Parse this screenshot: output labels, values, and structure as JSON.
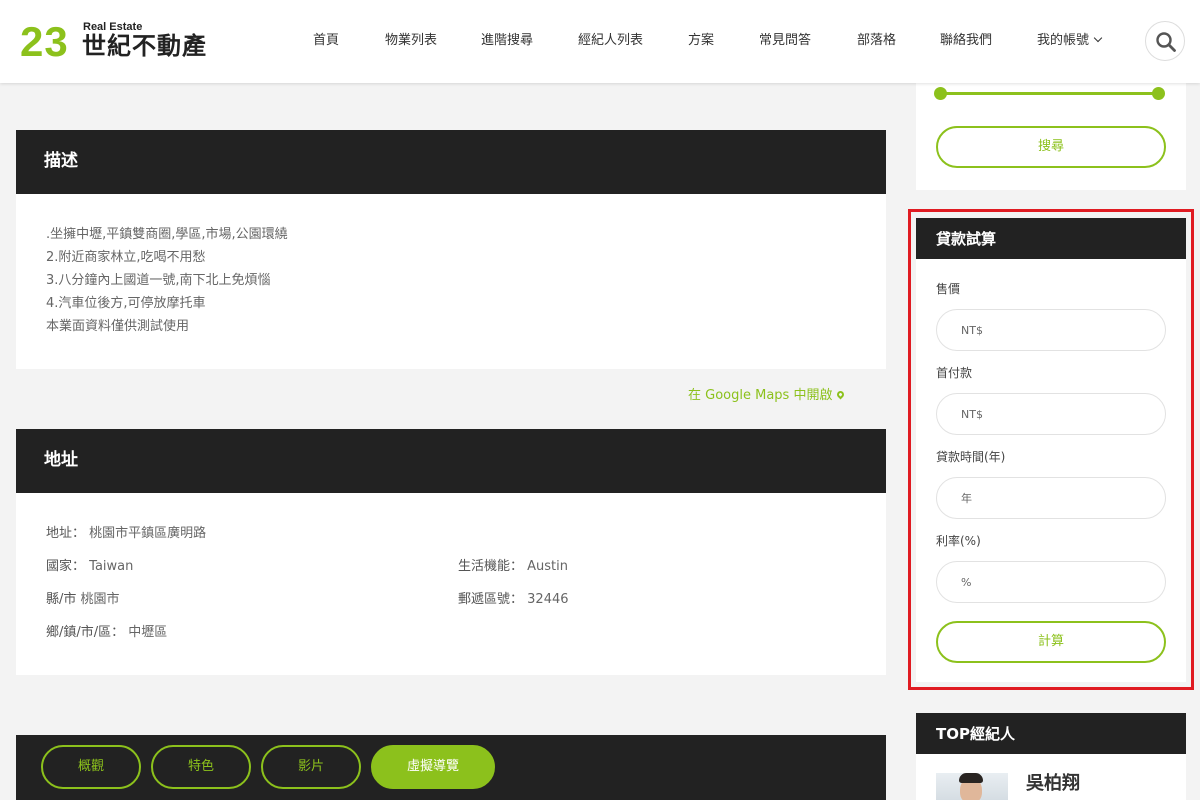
{
  "header": {
    "logo_number": "23",
    "logo_en": "Real Estate",
    "logo_cn": "世紀不動產",
    "nav": [
      {
        "label": "首頁"
      },
      {
        "label": "物業列表"
      },
      {
        "label": "進階搜尋"
      },
      {
        "label": "經紀人列表"
      },
      {
        "label": "方案"
      },
      {
        "label": "常見問答"
      },
      {
        "label": "部落格"
      },
      {
        "label": "聯絡我們"
      },
      {
        "label": "我的帳號"
      }
    ]
  },
  "description": {
    "title": "描述",
    "lines": [
      ".坐擁中壢,平鎮雙商圈,學區,市場,公園環繞",
      "2.附近商家林立,吃喝不用愁",
      "3.八分鐘內上國道一號,南下北上免煩惱",
      "4.汽車位後方,可停放摩托車",
      "本業面資料僅供測試使用"
    ]
  },
  "google_maps_link": "在 Google Maps 中開啟",
  "address": {
    "title": "地址",
    "street_label": "地址：",
    "street_value": "桃園市平鎮區廣明路",
    "country_label": "國家：",
    "country_value": "Taiwan",
    "county_label": "縣/市",
    "county_value": "桃園市",
    "township_label": "鄉/鎮/市/區：",
    "township_value": "中壢區",
    "amenity_label": "生活機能：",
    "amenity_value": "Austin",
    "zip_label": "郵遞區號：",
    "zip_value": "32446"
  },
  "tabs": [
    {
      "label": "概觀"
    },
    {
      "label": "特色"
    },
    {
      "label": "影片"
    },
    {
      "label": "虛擬導覽"
    }
  ],
  "sidebar": {
    "search_button": "搜尋",
    "loan": {
      "title": "貸款試算",
      "price_label": "售價",
      "price_placeholder": "NT$",
      "down_label": "首付款",
      "down_placeholder": "NT$",
      "term_label": "貸款時間(年)",
      "term_placeholder": "年",
      "rate_label": "利率(%)",
      "rate_placeholder": "%",
      "calc_button": "計算"
    },
    "top_agents": {
      "title": "TOP經紀人",
      "agent_name": "吳柏翔"
    }
  },
  "colors": {
    "accent": "#8cc11c",
    "dark": "#222222",
    "highlight_frame": "#e01b22"
  }
}
